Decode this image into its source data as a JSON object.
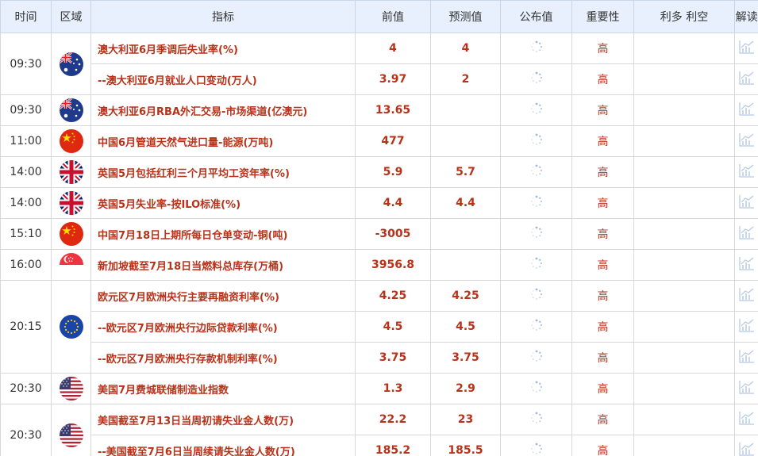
{
  "header": {
    "time": "时间",
    "region": "区域",
    "indicator": "指标",
    "previous": "前值",
    "forecast": "预测值",
    "actual": "公布值",
    "importance": "重要性",
    "impact": "利多 利空",
    "analysis": "解读"
  },
  "colors": {
    "accent": "#b8321a",
    "header_bg": "#e8f0fd"
  },
  "rows": [
    {
      "time": "09:30",
      "flag": "australia-flag-icon",
      "events": [
        {
          "indicator": "澳大利亚6月季调后失业率(%)",
          "previous": "4",
          "forecast": "4",
          "importance": "高"
        },
        {
          "indicator": "--澳大利亚6月就业人口变动(万人)",
          "previous": "3.97",
          "forecast": "2",
          "importance": "高"
        }
      ]
    },
    {
      "time": "09:30",
      "flag": "australia-flag-icon",
      "events": [
        {
          "indicator": "澳大利亚6月RBA外汇交易-市场渠道(亿澳元)",
          "previous": "13.65",
          "forecast": "",
          "importance": "高"
        }
      ]
    },
    {
      "time": "11:00",
      "flag": "china-flag-icon",
      "events": [
        {
          "indicator": "中国6月管道天然气进口量-能源(万吨)",
          "previous": "477",
          "forecast": "",
          "importance": "高"
        }
      ]
    },
    {
      "time": "14:00",
      "flag": "uk-flag-icon",
      "events": [
        {
          "indicator": "英国5月包括红利三个月平均工资年率(%)",
          "previous": "5.9",
          "forecast": "5.7",
          "importance": "高"
        }
      ]
    },
    {
      "time": "14:00",
      "flag": "uk-flag-icon",
      "events": [
        {
          "indicator": "英国5月失业率-按ILO标准(%)",
          "previous": "4.4",
          "forecast": "4.4",
          "importance": "高"
        }
      ]
    },
    {
      "time": "15:10",
      "flag": "china-flag-icon",
      "events": [
        {
          "indicator": "中国7月18日上期所每日仓单变动-铜(吨)",
          "previous": "-3005",
          "forecast": "",
          "importance": "高"
        }
      ]
    },
    {
      "time": "16:00",
      "flag": "singapore-flag-icon",
      "events": [
        {
          "indicator": "新加坡截至7月18日当燃料总库存(万桶)",
          "previous": "3956.8",
          "forecast": "",
          "importance": "高"
        }
      ]
    },
    {
      "time": "20:15",
      "flag": "eu-flag-icon",
      "events": [
        {
          "indicator": "欧元区7月欧洲央行主要再融资利率(%)",
          "previous": "4.25",
          "forecast": "4.25",
          "importance": "高"
        },
        {
          "indicator": "--欧元区7月欧洲央行边际贷款利率(%)",
          "previous": "4.5",
          "forecast": "4.5",
          "importance": "高"
        },
        {
          "indicator": "--欧元区7月欧洲央行存款机制利率(%)",
          "previous": "3.75",
          "forecast": "3.75",
          "importance": "高"
        }
      ]
    },
    {
      "time": "20:30",
      "flag": "usa-flag-icon",
      "events": [
        {
          "indicator": "美国7月费城联储制造业指数",
          "previous": "1.3",
          "forecast": "2.9",
          "importance": "高"
        }
      ]
    },
    {
      "time": "20:30",
      "flag": "usa-flag-icon",
      "events": [
        {
          "indicator": "美国截至7月13日当周初请失业金人数(万)",
          "previous": "22.2",
          "forecast": "23",
          "importance": "高"
        },
        {
          "indicator": "--美国截至7月6日当周续请失业金人数(万)",
          "previous": "185.2",
          "forecast": "185.5",
          "importance": "高"
        }
      ]
    }
  ]
}
